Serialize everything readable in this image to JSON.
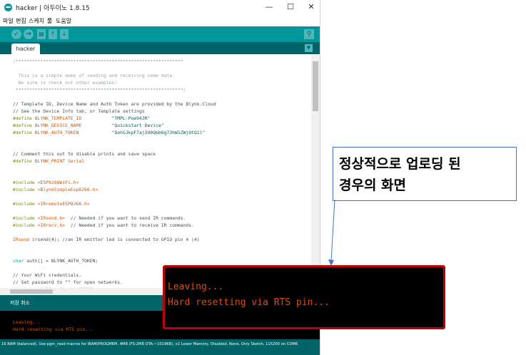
{
  "window": {
    "title": "hacker | 아두이노 1.8.15",
    "controls": {
      "minimize": "—",
      "maximize": "☐",
      "close": "✕"
    }
  },
  "menubar": [
    "파일",
    "편집",
    "스케치",
    "툴",
    "도움말"
  ],
  "toolbar": {
    "verify_icon": "check-icon",
    "upload_icon": "right-arrow-icon",
    "new_icon": "new-file-icon",
    "open_icon": "open-arrow-up-icon",
    "save_icon": "save-arrow-down-icon",
    "serial_monitor_icon": "magnifier-icon"
  },
  "tabs": {
    "sketch": "hacker"
  },
  "code_lines": [
    {
      "cls": "c",
      "text": "/*************************************************************"
    },
    {
      "cls": "c",
      "text": ""
    },
    {
      "cls": "c",
      "text": "  This is a simple demo of sending and receiving some data."
    },
    {
      "cls": "c",
      "text": "  Be sure to check out other examples!"
    },
    {
      "cls": "c",
      "text": " *************************************************************/"
    },
    {
      "cls": "",
      "text": ""
    },
    {
      "cls": "",
      "text": "// Template ID, Device Name and Auth Token are provided by the Blynk.Cloud"
    },
    {
      "cls": "",
      "text": "// See the Device Info tab, or Template settings"
    },
    {
      "cls": "def",
      "kw": "#define ",
      "name": "BLYNK_TEMPLATE_ID",
      "pad": "           ",
      "val": "\"TMPL-Poe94JR\""
    },
    {
      "cls": "def",
      "kw": "#define ",
      "name": "BLYNK_DEVICE_NAME",
      "pad": "           ",
      "val": "\"Quickstart Device\""
    },
    {
      "cls": "def",
      "kw": "#define ",
      "name": "BLYNK_AUTH_TOKEN",
      "pad": "            ",
      "val": "\"OohGJkpF7aj3U0Qbb6g73hW1ZWjOtQ1l\""
    },
    {
      "cls": "",
      "text": ""
    },
    {
      "cls": "",
      "text": ""
    },
    {
      "cls": "",
      "text": "// Comment this out to disable prints and save space"
    },
    {
      "cls": "def",
      "kw": "#define ",
      "name": "BLYNK_PRINT Serial",
      "pad": "",
      "val": ""
    },
    {
      "cls": "",
      "text": ""
    },
    {
      "cls": "",
      "text": ""
    },
    {
      "cls": "inc",
      "kw": "#include ",
      "lib": "<ESP8266WiFi.h>",
      "comment": ""
    },
    {
      "cls": "inc",
      "kw": "#include ",
      "lib": "<BlynkSimpleEsp8266.h>",
      "comment": ""
    },
    {
      "cls": "",
      "text": ""
    },
    {
      "cls": "inc",
      "kw": "#include ",
      "lib": "<IRremoteESP8266.h>",
      "comment": ""
    },
    {
      "cls": "",
      "text": ""
    },
    {
      "cls": "inc",
      "kw": "#include ",
      "lib": "<IRsend.h>",
      "comment": "  // Needed if you want to send IR commands."
    },
    {
      "cls": "inc",
      "kw": "#include ",
      "lib": "<IRrecv.h>",
      "comment": "  // Needed if you want to receive IR commands."
    },
    {
      "cls": "",
      "text": ""
    },
    {
      "cls": "ir",
      "type": "IRsend",
      "rest": " irsend(4); //an IR emitter led is connected to GPIO pin 4 (4)"
    },
    {
      "cls": "",
      "text": ""
    },
    {
      "cls": "",
      "text": ""
    },
    {
      "cls": "chr",
      "type": "char",
      "rest": " auth[] = BLYNK_AUTH_TOKEN;"
    },
    {
      "cls": "",
      "text": ""
    },
    {
      "cls": "",
      "text": "// Your WiFi credentials."
    },
    {
      "cls": "",
      "text": "// Set password to \"\" for open networks."
    },
    {
      "cls": "",
      "text": "// char ssid[] = \"hackerXXXX\";"
    }
  ],
  "status_bar": {
    "text": "저장 취소"
  },
  "console_lines": [
    "Leaving...",
    "Hard resetting via RTS pin..."
  ],
  "footer": {
    "text": "16 RAM (balanced), Use pgm_read macros for IRAM/PROGMEM, 4MB (FS:2MB OTA:~1019KB), v2 Lower Memory, Disabled, None, Only Sketch, 115200 on COM6"
  },
  "annotation": {
    "line1": "정상적으로 업로딩 된",
    "line2": "경우의 화면",
    "border_color": "#4472c4"
  },
  "zoom_inset": {
    "line1": "Leaving...",
    "line2": "Hard resetting via RTS pin...",
    "border_color": "#c00000",
    "text_color": "#e34c00"
  },
  "colors": {
    "teal": "#00979c",
    "dark_teal": "#006468"
  }
}
